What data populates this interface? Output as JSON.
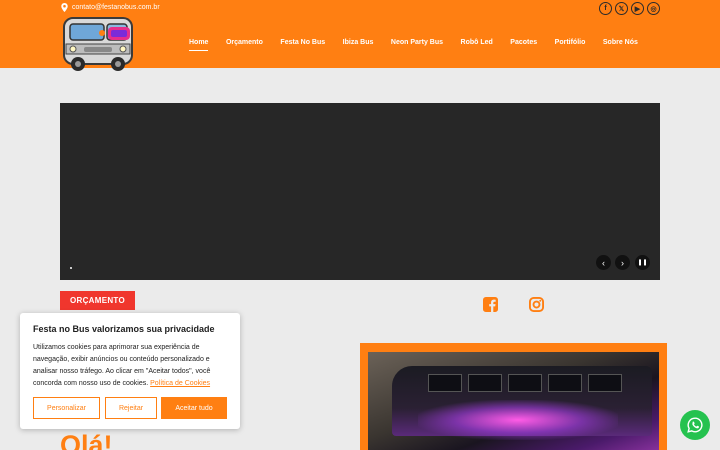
{
  "topbar": {
    "email": "contato@festanobus.com.br",
    "social": [
      {
        "icon": "facebook-icon",
        "glyph": "f"
      },
      {
        "icon": "x-twitter-icon",
        "glyph": "𝕏"
      },
      {
        "icon": "youtube-icon",
        "glyph": "▶"
      },
      {
        "icon": "instagram-icon",
        "glyph": "◎"
      }
    ]
  },
  "logo": {
    "icon": "festa-no-bus-logo"
  },
  "nav": {
    "items": [
      "Home",
      "Orçamento",
      "Festa No Bus",
      "Ibiza Bus",
      "Neon Party Bus",
      "Robô Led",
      "Pacotes",
      "Portifólio",
      "Sobre Nós"
    ],
    "active": "Home"
  },
  "slider": {
    "prev_glyph": "‹",
    "next_glyph": "›",
    "pause_glyph": "❚❚"
  },
  "content": {
    "orcamento_button": "ORÇAMENTO",
    "greeting": "Olá!"
  },
  "cookie": {
    "title": "Festa no Bus valorizamos sua privacidade",
    "text": "Utilizamos cookies para aprimorar sua experiência de navegação, exibir anúncios ou conteúdo personalizado e analisar nosso tráfego. Ao clicar em \"Aceitar todos\", você concorda com nosso uso de cookies. ",
    "link": "Política de Cookies",
    "customize": "Personalizar",
    "reject": "Rejeitar",
    "accept": "Aceitar tudo"
  },
  "colors": {
    "brand": "#ff7f12",
    "button_red": "#f0362d",
    "whatsapp": "#25c24f"
  }
}
